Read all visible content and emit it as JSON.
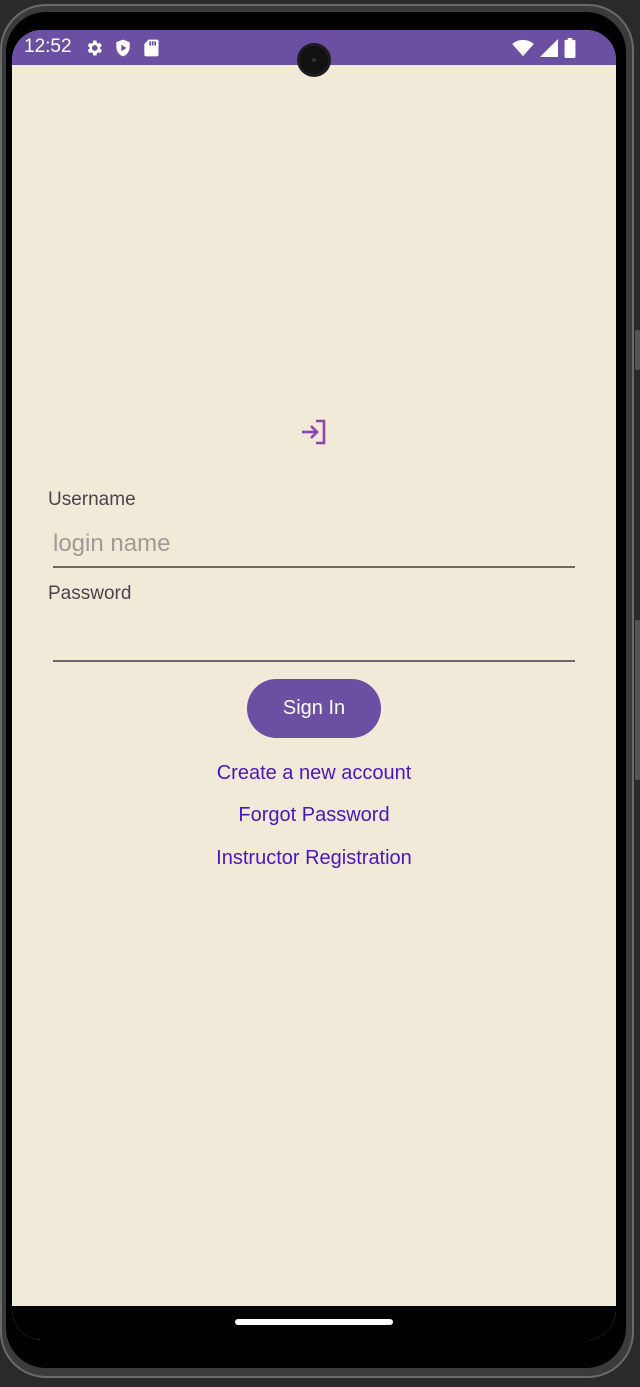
{
  "status_bar": {
    "time": "12:52",
    "left_icons": [
      "gear-icon",
      "play-protect-icon",
      "sd-card-icon"
    ],
    "right_icons": [
      "wifi-icon",
      "cell-signal-icon",
      "battery-icon"
    ]
  },
  "login": {
    "icon": "login-arrow-icon",
    "username": {
      "label": "Username",
      "value": "",
      "placeholder": "login name"
    },
    "password": {
      "label": "Password",
      "value": "",
      "placeholder": ""
    },
    "signin_label": "Sign In",
    "links": {
      "create_account": "Create a new account",
      "forgot_password": "Forgot Password",
      "instructor_registration": "Instructor Registration"
    }
  },
  "colors": {
    "primary": "#6b4fa3",
    "background": "#f1ead8",
    "link": "#4a16c0",
    "icon": "#8e44ad"
  }
}
